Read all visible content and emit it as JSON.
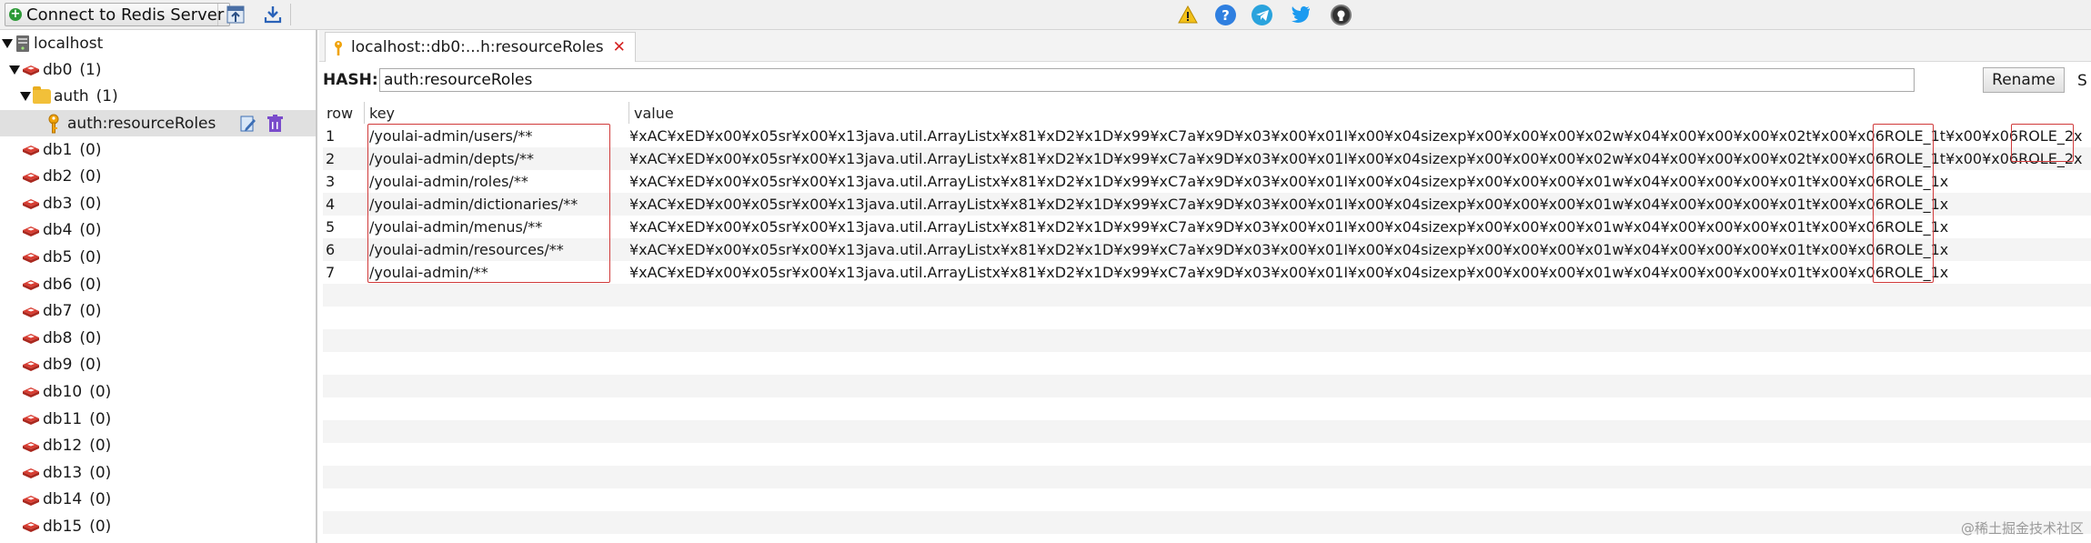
{
  "toolbar": {
    "connect_label": "Connect to Redis Server",
    "icons": [
      "import-icon",
      "export-icon",
      "warning-icon",
      "help-icon",
      "telegram-icon",
      "twitter-icon",
      "github-icon"
    ]
  },
  "tree": {
    "server": "localhost",
    "db0": {
      "label": "db0",
      "count": "(1)"
    },
    "folder": {
      "label": "auth",
      "count": "(1)"
    },
    "key": "auth:resourceRoles",
    "dbs": [
      {
        "label": "db1",
        "count": "(0)"
      },
      {
        "label": "db2",
        "count": "(0)"
      },
      {
        "label": "db3",
        "count": "(0)"
      },
      {
        "label": "db4",
        "count": "(0)"
      },
      {
        "label": "db5",
        "count": "(0)"
      },
      {
        "label": "db6",
        "count": "(0)"
      },
      {
        "label": "db7",
        "count": "(0)"
      },
      {
        "label": "db8",
        "count": "(0)"
      },
      {
        "label": "db9",
        "count": "(0)"
      },
      {
        "label": "db10",
        "count": "(0)"
      },
      {
        "label": "db11",
        "count": "(0)"
      },
      {
        "label": "db12",
        "count": "(0)"
      },
      {
        "label": "db13",
        "count": "(0)"
      },
      {
        "label": "db14",
        "count": "(0)"
      },
      {
        "label": "db15",
        "count": "(0)"
      }
    ]
  },
  "tab": {
    "label": "localhost::db0:...h:resourceRoles",
    "close": "✕"
  },
  "hash": {
    "label": "HASH:",
    "value": "auth:resourceRoles",
    "rename": "Rename",
    "more": "S"
  },
  "table": {
    "headers": {
      "row": "row",
      "key": "key",
      "value": "value"
    },
    "rows": [
      {
        "row": "1",
        "key": "/youlai-admin/users/**",
        "value": "¥xAC¥xED¥x00¥x05sr¥x00¥x13java.util.ArrayListx¥x81¥xD2¥x1D¥x99¥xC7a¥x9D¥x03¥x00¥x01I¥x00¥x04sizexp¥x00¥x00¥x00¥x02w¥x04¥x00¥x00¥x00¥x02t¥x00¥x06ROLE_1t¥x00¥x06ROLE_2x"
      },
      {
        "row": "2",
        "key": "/youlai-admin/depts/**",
        "value": "¥xAC¥xED¥x00¥x05sr¥x00¥x13java.util.ArrayListx¥x81¥xD2¥x1D¥x99¥xC7a¥x9D¥x03¥x00¥x01I¥x00¥x04sizexp¥x00¥x00¥x00¥x02w¥x04¥x00¥x00¥x00¥x02t¥x00¥x06ROLE_1t¥x00¥x06ROLE_2x"
      },
      {
        "row": "3",
        "key": "/youlai-admin/roles/**",
        "value": "¥xAC¥xED¥x00¥x05sr¥x00¥x13java.util.ArrayListx¥x81¥xD2¥x1D¥x99¥xC7a¥x9D¥x03¥x00¥x01I¥x00¥x04sizexp¥x00¥x00¥x00¥x01w¥x04¥x00¥x00¥x00¥x01t¥x00¥x06ROLE_1x"
      },
      {
        "row": "4",
        "key": "/youlai-admin/dictionaries/**",
        "value": "¥xAC¥xED¥x00¥x05sr¥x00¥x13java.util.ArrayListx¥x81¥xD2¥x1D¥x99¥xC7a¥x9D¥x03¥x00¥x01I¥x00¥x04sizexp¥x00¥x00¥x00¥x01w¥x04¥x00¥x00¥x00¥x01t¥x00¥x06ROLE_1x"
      },
      {
        "row": "5",
        "key": "/youlai-admin/menus/**",
        "value": "¥xAC¥xED¥x00¥x05sr¥x00¥x13java.util.ArrayListx¥x81¥xD2¥x1D¥x99¥xC7a¥x9D¥x03¥x00¥x01I¥x00¥x04sizexp¥x00¥x00¥x00¥x01w¥x04¥x00¥x00¥x00¥x01t¥x00¥x06ROLE_1x"
      },
      {
        "row": "6",
        "key": "/youlai-admin/resources/**",
        "value": "¥xAC¥xED¥x00¥x05sr¥x00¥x13java.util.ArrayListx¥x81¥xD2¥x1D¥x99¥xC7a¥x9D¥x03¥x00¥x01I¥x00¥x04sizexp¥x00¥x00¥x00¥x01w¥x04¥x00¥x00¥x00¥x01t¥x00¥x06ROLE_1x"
      },
      {
        "row": "7",
        "key": "/youlai-admin/**",
        "value": "¥xAC¥xED¥x00¥x05sr¥x00¥x13java.util.ArrayListx¥x81¥xD2¥x1D¥x99¥xC7a¥x9D¥x03¥x00¥x01I¥x00¥x04sizexp¥x00¥x00¥x00¥x01w¥x04¥x00¥x00¥x00¥x01t¥x00¥x06ROLE_1x"
      }
    ]
  },
  "watermark": "@稀土掘金技术社区",
  "colors": {
    "highlight": "#d03a3a",
    "redis_red": "#c9302c",
    "folder": "#f2c039"
  }
}
